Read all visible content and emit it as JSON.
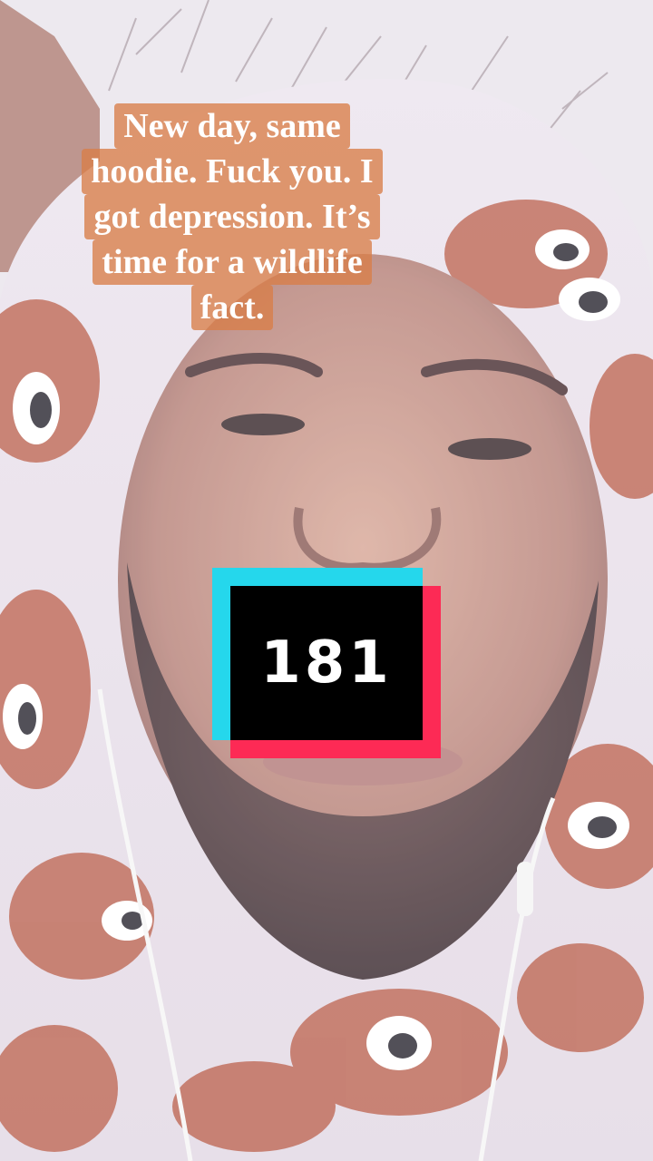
{
  "caption": {
    "lines": [
      "New day, same",
      "hoodie. Fuck you. I",
      "got depression. It’s",
      "time for a wildlife",
      "fact."
    ]
  },
  "counter": {
    "value": "181",
    "colors": {
      "cyan": "#25d7ec",
      "red": "#fd2a55",
      "inner": "#000000",
      "text": "#ffffff"
    }
  },
  "caption_style": {
    "highlight_color": "#d87e48",
    "text_color": "#ffffff"
  }
}
